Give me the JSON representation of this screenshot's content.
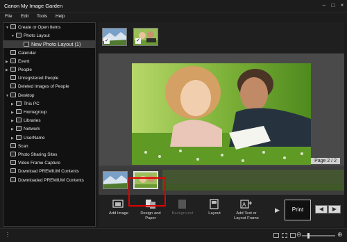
{
  "window": {
    "title": "Canon My Image Garden"
  },
  "menu": [
    "File",
    "Edit",
    "Tools",
    "Help"
  ],
  "sidebar": {
    "items": [
      {
        "label": "Create or Open Items",
        "arrow": "▼",
        "icon": "create-items-icon"
      },
      {
        "label": "Photo Layout",
        "arrow": "▼",
        "icon": "photo-layout-icon"
      },
      {
        "label": "New Photo Layout (1)",
        "arrow": "",
        "icon": "layout-file-icon",
        "selected": true
      },
      {
        "label": "Calendar",
        "arrow": "",
        "icon": "calendar-icon"
      },
      {
        "label": "Event",
        "arrow": "▶",
        "icon": "event-icon"
      },
      {
        "label": "People",
        "arrow": "▶",
        "icon": "people-icon"
      },
      {
        "label": "Unregistered People",
        "arrow": "",
        "icon": "unregistered-people-icon"
      },
      {
        "label": "Deleted Images of People",
        "arrow": "",
        "icon": "deleted-images-icon"
      },
      {
        "label": "Desktop",
        "arrow": "▼",
        "icon": "desktop-icon"
      },
      {
        "label": "This PC",
        "arrow": "▶",
        "icon": "pc-icon"
      },
      {
        "label": "Homegroup",
        "arrow": "▶",
        "icon": "homegroup-icon"
      },
      {
        "label": "Libraries",
        "arrow": "▶",
        "icon": "libraries-icon"
      },
      {
        "label": "Network",
        "arrow": "▶",
        "icon": "network-icon"
      },
      {
        "label": "UserName",
        "arrow": "▶",
        "icon": "user-folder-icon"
      },
      {
        "label": "Scan",
        "arrow": "",
        "icon": "scan-icon"
      },
      {
        "label": "Photo Sharing Sites",
        "arrow": "",
        "icon": "sharing-sites-icon"
      },
      {
        "label": "Video Frame Capture",
        "arrow": "",
        "icon": "video-capture-icon"
      },
      {
        "label": "Download PREMIUM Contents",
        "arrow": "",
        "icon": "download-icon"
      },
      {
        "label": "Downloaded PREMIUM Contents",
        "arrow": "",
        "icon": "downloaded-icon"
      }
    ]
  },
  "canvas": {
    "page_indicator": "Page 2 / 2"
  },
  "toolbar": {
    "add_image": "Add Image",
    "design_paper_1": "Design and",
    "design_paper_2": "Paper",
    "background": "Background",
    "layout": "Layout",
    "add_text_1": "Add Text or",
    "add_text_2": "Layout Frame",
    "print": "Print"
  },
  "colors": {
    "highlight": "#e00000",
    "background": "#1b1b1b",
    "canvas": "#4a4a4a"
  }
}
